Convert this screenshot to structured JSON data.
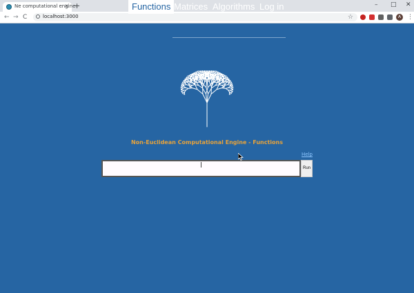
{
  "browser": {
    "tab_title": "Ne computational engine",
    "tab_close": "×",
    "new_tab": "+",
    "window_controls": {
      "minimize": "–",
      "maximize": "□",
      "close": "✕"
    },
    "back": "←",
    "forward": "→",
    "reload": "C",
    "url": "localhost:3000",
    "bookmark": "☆",
    "profile_initial": "A",
    "menu": "⋮",
    "extensions": [
      {
        "name": "extension-red",
        "color": "#c5221f"
      },
      {
        "name": "extension-shield",
        "color": "#d32f2f"
      },
      {
        "name": "extension-gray",
        "color": "#616161"
      },
      {
        "name": "puzzle",
        "color": "#5f6368"
      }
    ]
  },
  "nav": {
    "items": [
      "Functions",
      "Matrices",
      "Algorithms",
      "Log in"
    ],
    "active": "Functions"
  },
  "main": {
    "heading": "Non-Euclidean Computational Engine - Functions",
    "help_link": "Help",
    "input_value": "",
    "run_label": "Run"
  },
  "colors": {
    "background": "#2665a3",
    "heading": "#e8a33a",
    "help_link": "#8fc7ff"
  }
}
